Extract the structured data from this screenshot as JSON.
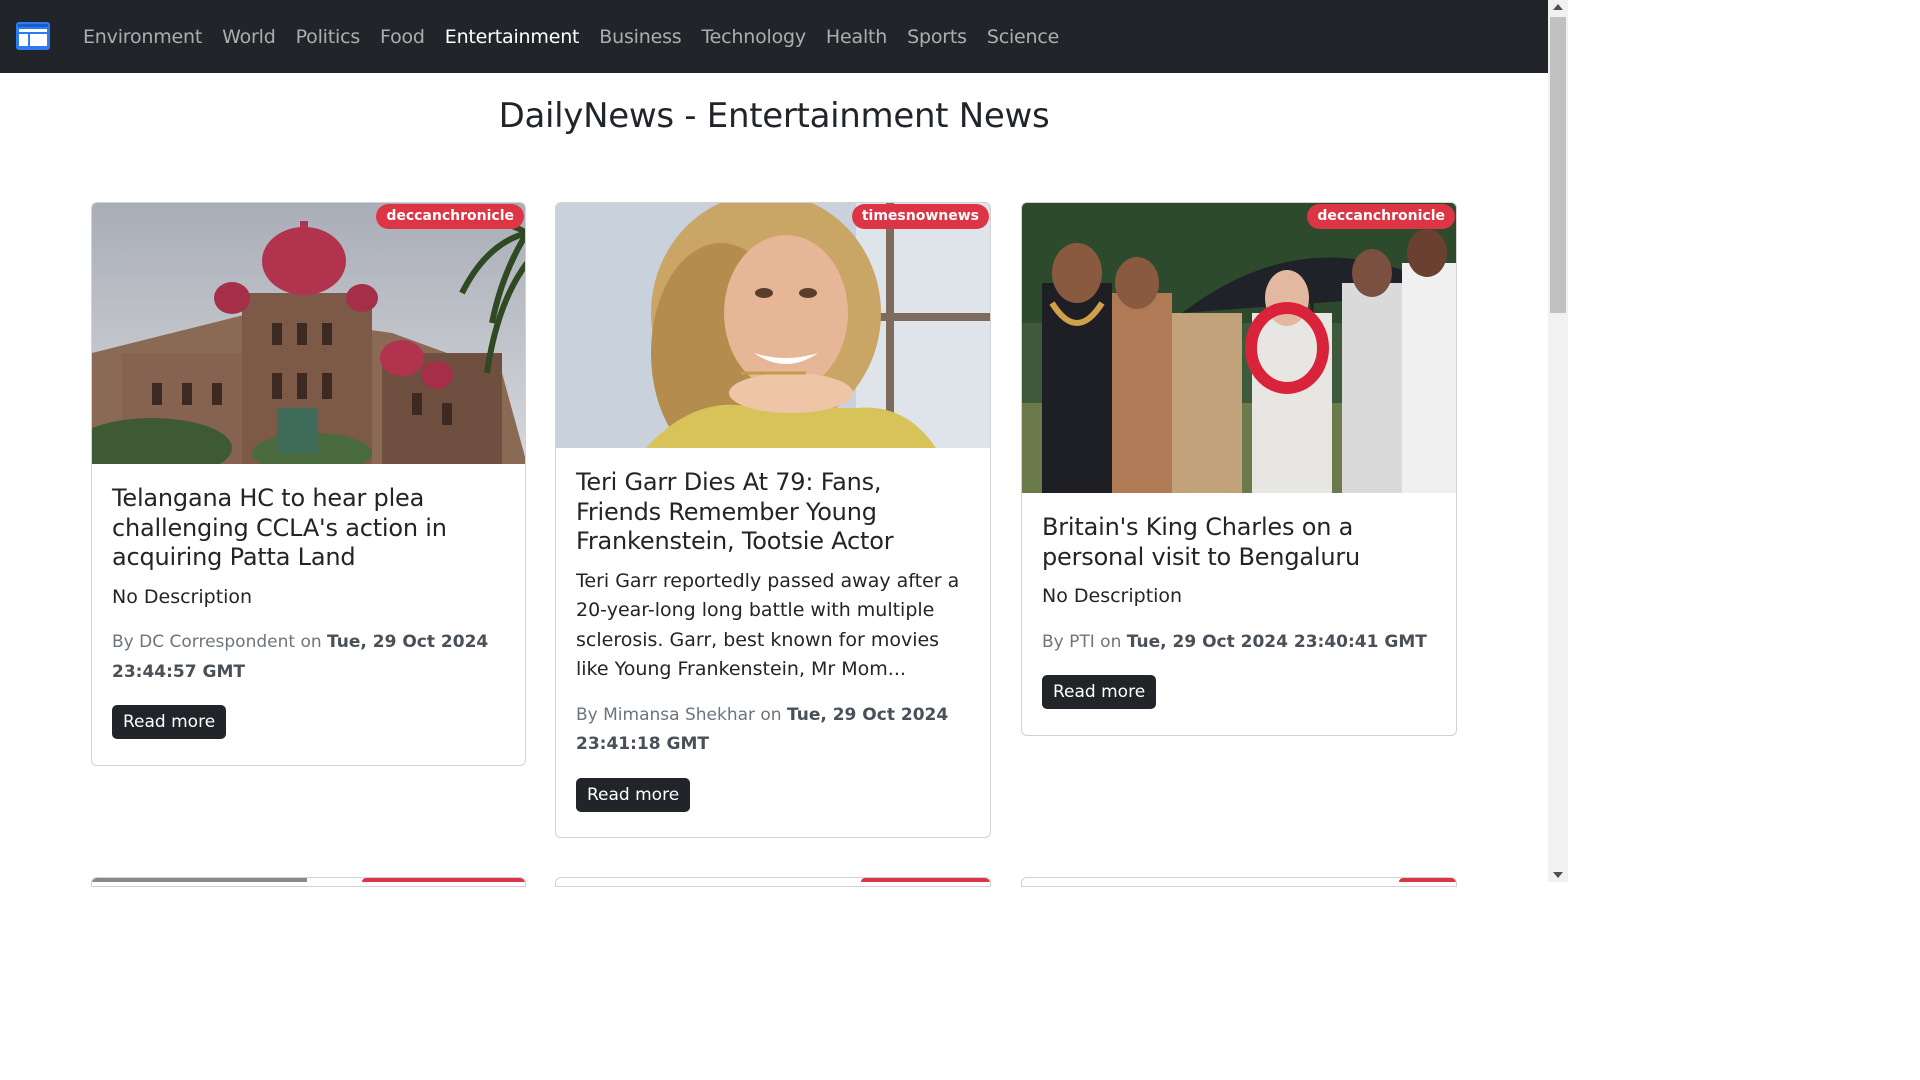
{
  "nav": {
    "items": [
      {
        "label": "Environment",
        "active": false
      },
      {
        "label": "World",
        "active": false
      },
      {
        "label": "Politics",
        "active": false
      },
      {
        "label": "Food",
        "active": false
      },
      {
        "label": "Entertainment",
        "active": true
      },
      {
        "label": "Business",
        "active": false
      },
      {
        "label": "Technology",
        "active": false
      },
      {
        "label": "Health",
        "active": false
      },
      {
        "label": "Sports",
        "active": false
      },
      {
        "label": "Science",
        "active": false
      }
    ]
  },
  "page": {
    "title": "DailyNews - Entertainment News"
  },
  "articles": [
    {
      "source": "deccanchronicle",
      "title": "Telangana HC to hear plea challenging CCLA's action in acquiring Patta Land",
      "description": "No Description",
      "by_prefix": "By DC Correspondent on",
      "date": "Tue, 29 Oct 2024 23:44:57 GMT",
      "read_more": "Read more",
      "image": "court-building-photo"
    },
    {
      "source": "timesnownews",
      "title": "Teri Garr Dies At 79: Fans, Friends Remember Young Frankenstein, Tootsie Actor",
      "description": "Teri Garr reportedly passed away after a 20-year-long long battle with multiple sclerosis. Garr, best known for movies like Young Frankenstein, Mr Mom...",
      "by_prefix": "By Mimansa Shekhar on",
      "date": "Tue, 29 Oct 2024 23:41:18 GMT",
      "read_more": "Read more",
      "image": "actress-portrait-photo"
    },
    {
      "source": "deccanchronicle",
      "title": "Britain's King Charles on a personal visit to Bengaluru",
      "description": "No Description",
      "by_prefix": "By PTI on",
      "date": "Tue, 29 Oct 2024 23:40:41 GMT",
      "read_more": "Read more",
      "image": "king-charles-umbrella-photo"
    }
  ],
  "colors": {
    "navbar": "#212529",
    "badge": "#dc3545",
    "button": "#212529",
    "brand": "#0d6efd"
  }
}
